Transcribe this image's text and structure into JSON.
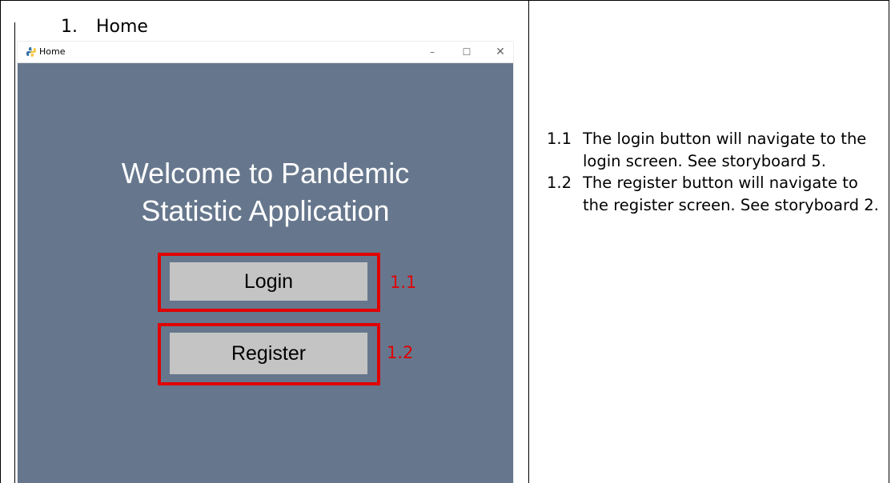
{
  "section": {
    "number": "1.",
    "title": "Home"
  },
  "window": {
    "title": "Home",
    "controls": {
      "minimize": "–",
      "maximize": "☐",
      "close": "✕"
    },
    "heading_line1": "Welcome to Pandemic",
    "heading_line2": "Statistic Application",
    "buttons": {
      "login": "Login",
      "register": "Register"
    },
    "background_color": "#66778d"
  },
  "annotations": [
    {
      "label": "1.1",
      "color": "#e00000"
    },
    {
      "label": "1.2",
      "color": "#e00000"
    }
  ],
  "notes": [
    {
      "number": "1.1",
      "text": "The login button will navigate to the login screen. See storyboard 5."
    },
    {
      "number": "1.2",
      "text": "The register button will navigate to the register screen. See storyboard 2."
    }
  ]
}
